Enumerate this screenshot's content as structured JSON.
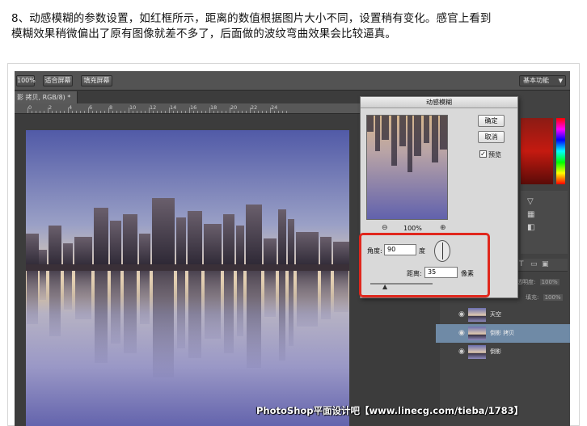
{
  "caption": {
    "line1": "8、动感模糊的参数设置，如红框所示，距离的数值根据图片大小不同，设置稍有变化。感官上看到",
    "line2": "模糊效果稍微偏出了原有图像就差不多了，后面做的波纹弯曲效果会比较逼真。"
  },
  "optionsbar": {
    "zoom_btn": "100%",
    "fit_screen_btn": "适合屏幕",
    "fill_screen_btn": "填充屏幕",
    "workspace": "基本功能"
  },
  "document": {
    "tab_title": "影 拷贝, RGB/8) *",
    "ruler_labels": [
      "0",
      "2",
      "4",
      "6",
      "8",
      "10",
      "12",
      "14",
      "16",
      "18",
      "20",
      "22",
      "24"
    ]
  },
  "dialog": {
    "title": "动感模糊",
    "ok": "确定",
    "cancel": "取消",
    "preview_label": "预览",
    "preview_checked": true,
    "zoom_level": "100%",
    "zoom_out": "⊖",
    "zoom_in": "⊕",
    "angle_label": "角度:",
    "angle_value": "90",
    "angle_unit": "度",
    "distance_label": "距离:",
    "distance_value": "35",
    "distance_unit": "像素"
  },
  "panels": {
    "opacity_label": "不透明度:",
    "opacity_value": "100%",
    "fill_label": "填充:",
    "fill_value": "100%",
    "layers": [
      {
        "name": "天空",
        "selected": false
      },
      {
        "name": "倒影 拷贝",
        "selected": true
      },
      {
        "name": "倒影",
        "selected": false
      }
    ]
  },
  "watermark": "PhotoShop平面设计吧【www.linecg.com/tieba/1783】",
  "colors": {
    "highlight_box": "#e0271d",
    "ps_background": "#3c3c3c",
    "selected_layer": "#6f8aa6",
    "color_swatch_red": "#c41a10"
  },
  "icons": {
    "eye": "eye-icon",
    "angle_dial": "angle-dial-icon",
    "checkbox": "checkbox-icon"
  }
}
